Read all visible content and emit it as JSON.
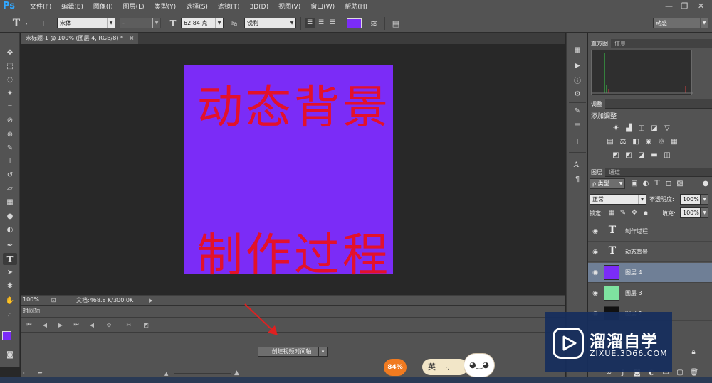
{
  "app": {
    "logo_text": "Ps"
  },
  "menu": {
    "items": [
      "文件(F)",
      "编辑(E)",
      "图像(I)",
      "图层(L)",
      "类型(Y)",
      "选择(S)",
      "滤镜(T)",
      "3D(D)",
      "视图(V)",
      "窗口(W)",
      "帮助(H)"
    ]
  },
  "window_controls": {
    "minimize": "—",
    "restore": "❐",
    "close": "✕"
  },
  "options_bar": {
    "tool_glyph": "T",
    "font_family": "宋体",
    "font_style": "-",
    "font_size": "62.84 点",
    "aa_label": "ªa",
    "antialias": "锐利",
    "text_color": "#7b2cf7",
    "workspace": "动感"
  },
  "document": {
    "tab_title": "未标题-1 @ 100% (图层 4, RGB/8) *",
    "tab_close": "×",
    "canvas_color": "#7b2cf7",
    "title_text": "动态背景",
    "subtitle_text": "制作过程",
    "text_color": "#e3112b"
  },
  "status_bar": {
    "zoom": "100%",
    "doc_info": "文档:468.8 K/300.0K"
  },
  "timeline": {
    "tab_label": "时间轴",
    "create_button": "创建视频时间轴",
    "dropdown_glyph": "▾"
  },
  "panels": {
    "histogram_tab": "直方图",
    "info_tab": "信息",
    "adjustments_tab": "调整",
    "adjustments_heading": "添加调整",
    "layers_tab": "图层",
    "channels_tab": "通道",
    "filter_kind": "ρ 类型",
    "blend_mode": "正常",
    "opacity_label": "不透明度:",
    "opacity_value": "100%",
    "lock_label": "锁定:",
    "fill_label": "填充:",
    "fill_value": "100%",
    "layers": [
      {
        "name": "制作过程",
        "kind": "text",
        "thumb": "",
        "selected": false
      },
      {
        "name": "动态背景",
        "kind": "text",
        "thumb": "",
        "selected": false
      },
      {
        "name": "图层 4",
        "kind": "pixel",
        "thumb": "#7b2cf7",
        "selected": true
      },
      {
        "name": "图层 3",
        "kind": "pixel",
        "thumb": "#7ee3a0",
        "selected": false
      },
      {
        "name": "图层 2",
        "kind": "pixel",
        "thumb": "#ffffff",
        "selected": false
      }
    ]
  },
  "watermark": {
    "title": "溜溜自学",
    "url": "ZIXUE.3D66.COM"
  },
  "widgets": {
    "speed_badge": "84%",
    "ime_label": "英",
    "ime_extra": "·,"
  },
  "colors": {
    "foreground": "#7b2cf7",
    "background": "#ffffff",
    "selection": "#6f7f96",
    "arrow": "#e02020"
  }
}
